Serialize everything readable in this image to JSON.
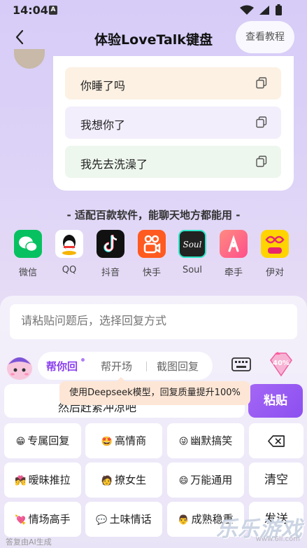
{
  "status_bar": {
    "time": "14:04",
    "notification_letter": "A"
  },
  "header": {
    "title": "体验LoveTalk键盘",
    "tutorial_button": "查看教程"
  },
  "suggestions": [
    {
      "text": "你睡了吗"
    },
    {
      "text": "我想你了"
    },
    {
      "text": "我先去洗澡了"
    }
  ],
  "subtitle": "- 适配百款软件，能聊天地方都能用 -",
  "apps": [
    {
      "label": "微信",
      "icon": "wechat-icon",
      "color": "#07c160"
    },
    {
      "label": "QQ",
      "icon": "qq-icon",
      "color": "#ffffff"
    },
    {
      "label": "抖音",
      "icon": "douyin-icon",
      "color": "#111111"
    },
    {
      "label": "快手",
      "icon": "kuaishou-icon",
      "color": "#ff5a1f"
    },
    {
      "label": "Soul",
      "icon": "soul-icon",
      "color": "#222222"
    },
    {
      "label": "牵手",
      "icon": "qianshou-icon",
      "color": "#ff5a7a"
    },
    {
      "label": "伊对",
      "icon": "yidui-icon",
      "color": "#ffd400"
    }
  ],
  "keyboard": {
    "input_placeholder": "请粘贴问题后，选择回复方式",
    "tabs": [
      "帮你回",
      "帮开场",
      "截图回复"
    ],
    "vip_badge": "40%",
    "tooltip": "使用Deepseek模型，回复质量提升100%",
    "reply_text": "然后赶紧冲凉吧",
    "paste_button": "粘贴",
    "keys": [
      {
        "emoji": "😁",
        "label": "专属回复"
      },
      {
        "emoji": "🤩",
        "label": "高情商"
      },
      {
        "emoji": "😜",
        "label": "幽默搞笑"
      },
      {
        "emoji": "💏",
        "label": "暧昧推拉"
      },
      {
        "emoji": "🧑",
        "label": "撩女生"
      },
      {
        "emoji": "😄",
        "label": "万能通用"
      },
      {
        "emoji": "💘",
        "label": "情场高手"
      },
      {
        "emoji": "💬",
        "label": "土味情话"
      },
      {
        "emoji": "👨",
        "label": "成熟稳重"
      }
    ],
    "clear_button": "清空",
    "send_button": "发送",
    "footer_note": "答复由AI生成"
  },
  "watermark": {
    "text": "乐乐游戏",
    "url": "www.6ll.com"
  },
  "colors": {
    "accent": "#8c4ff0",
    "tooltip_bg": "#fde6d5"
  }
}
